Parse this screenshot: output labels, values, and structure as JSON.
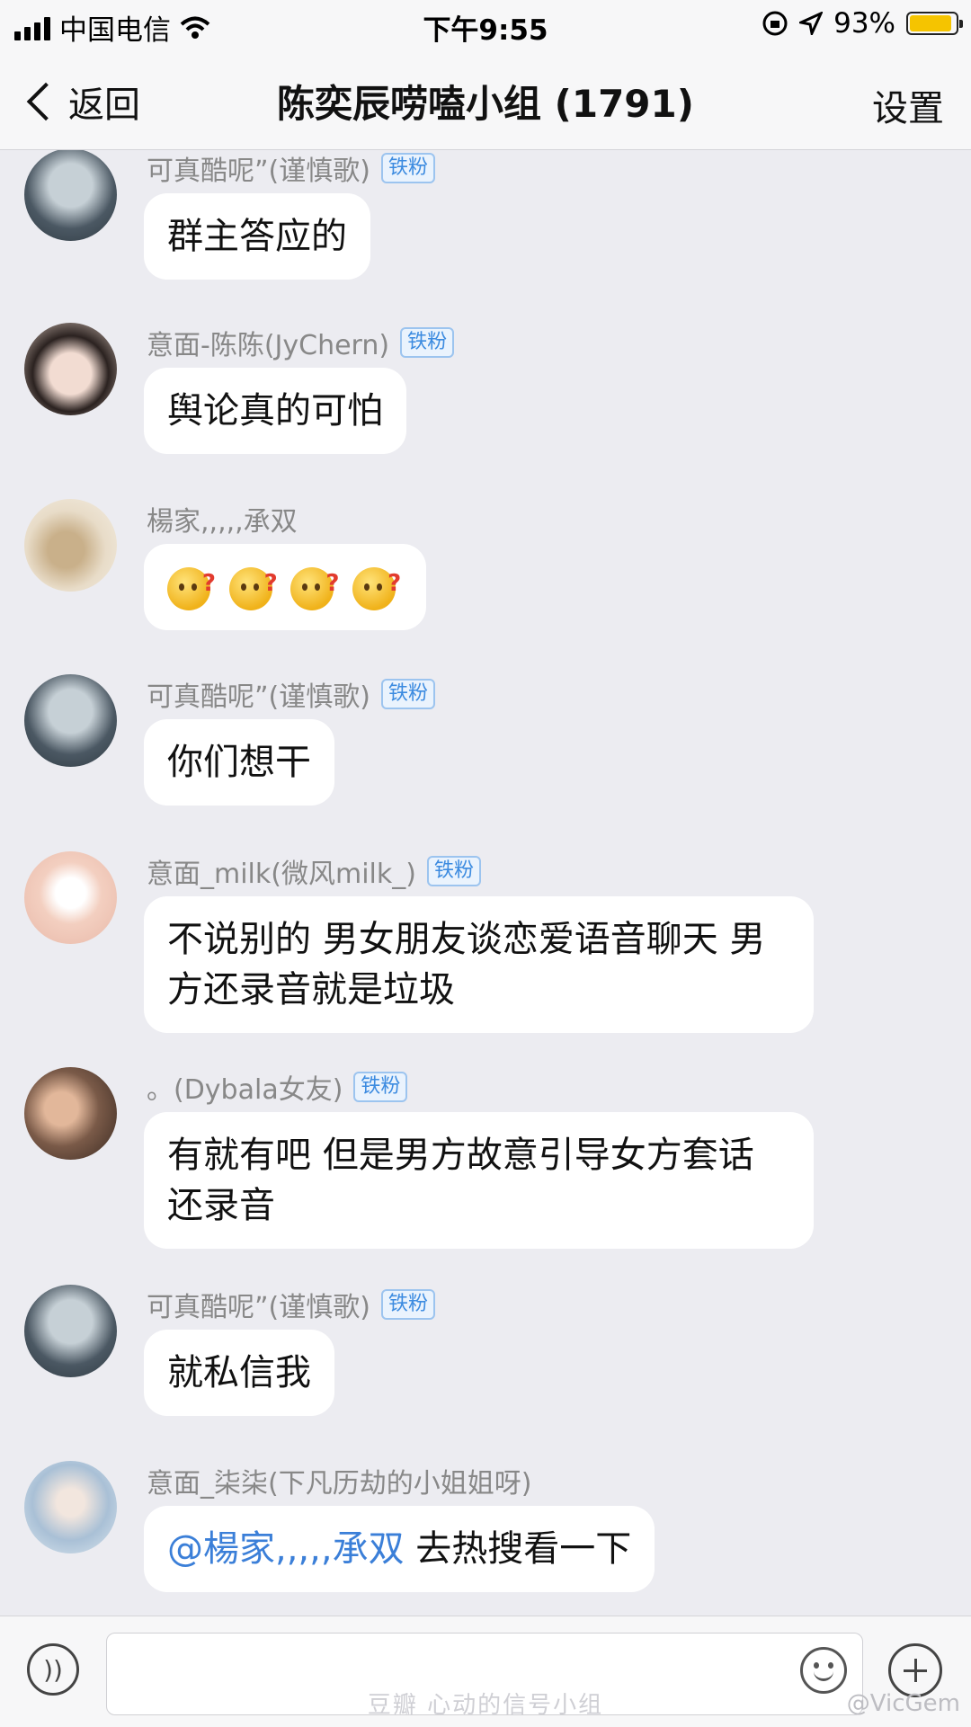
{
  "status_bar": {
    "carrier": "中国电信",
    "time": "下午9:55",
    "battery_percent": "93%",
    "battery_level": 0.93,
    "icons": [
      "signal-icon",
      "wifi-icon",
      "rotation-lock-icon",
      "location-icon",
      "battery-icon"
    ]
  },
  "nav": {
    "back_label": "返回",
    "title": "陈奕辰唠嗑小组 (1791)",
    "settings_label": "设置"
  },
  "messages": [
    {
      "sender": "可真酷呢”(谨慎歌)",
      "badge": "铁粉",
      "text": "群主答应的",
      "avatar_color": "#6f7c86"
    },
    {
      "sender": "意面-陈陈(JyChern)",
      "badge": "铁粉",
      "text": "舆论真的可怕",
      "avatar_color": "#c9a89a"
    },
    {
      "sender": "楊家,,,,,承双",
      "badge": "",
      "text": "",
      "emoji_count": 4,
      "avatar_color": "#d9c7a8"
    },
    {
      "sender": "可真酷呢”(谨慎歌)",
      "badge": "铁粉",
      "text": "你们想干",
      "avatar_color": "#6f7c86"
    },
    {
      "sender": "意面_milk(微风milk_)",
      "badge": "铁粉",
      "text_lines": [
        "不说别的 男女朋友谈恋爱语音聊天 男",
        "方还录音就是垃圾"
      ],
      "avatar_color": "#f3cfc0"
    },
    {
      "sender": "。(Dybala女友)",
      "badge": "铁粉",
      "text_lines": [
        "有就有吧 但是男方故意引导女方套话",
        "还录音"
      ],
      "avatar_color": "#8a6a55"
    },
    {
      "sender": "可真酷呢”(谨慎歌)",
      "badge": "铁粉",
      "text": "就私信我",
      "avatar_color": "#6f7c86"
    },
    {
      "sender": "意面_柒柒(下凡历劫的小姐姐呀)",
      "badge": "",
      "mention": "@楊家,,,,,承双",
      "text": " 去热搜看一下",
      "avatar_color": "#a9c0d6"
    }
  ],
  "input_bar": {
    "watermark": "豆瓣 心动的信号小组",
    "watermark_right": "@VicGem",
    "icons": [
      "voice-icon",
      "emoji-icon",
      "plus-icon"
    ]
  }
}
